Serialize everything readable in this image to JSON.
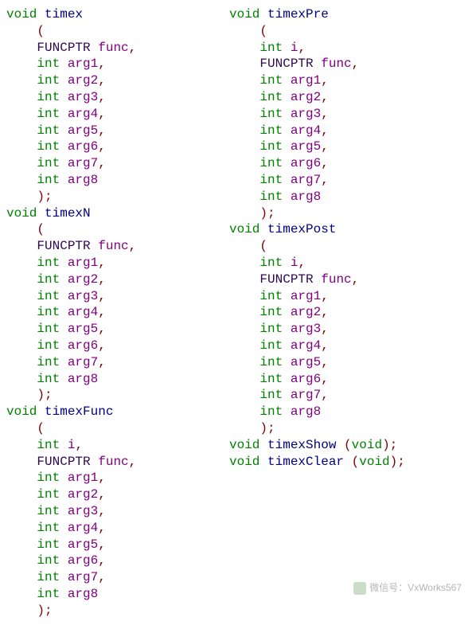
{
  "code": {
    "functions_left": [
      {
        "name": "timex",
        "params": [
          {
            "type": "FUNCPTR",
            "name": "func"
          },
          {
            "type": "int",
            "name": "arg1"
          },
          {
            "type": "int",
            "name": "arg2"
          },
          {
            "type": "int",
            "name": "arg3"
          },
          {
            "type": "int",
            "name": "arg4"
          },
          {
            "type": "int",
            "name": "arg5"
          },
          {
            "type": "int",
            "name": "arg6"
          },
          {
            "type": "int",
            "name": "arg7"
          },
          {
            "type": "int",
            "name": "arg8"
          }
        ]
      },
      {
        "name": "timexN",
        "params": [
          {
            "type": "FUNCPTR",
            "name": "func"
          },
          {
            "type": "int",
            "name": "arg1"
          },
          {
            "type": "int",
            "name": "arg2"
          },
          {
            "type": "int",
            "name": "arg3"
          },
          {
            "type": "int",
            "name": "arg4"
          },
          {
            "type": "int",
            "name": "arg5"
          },
          {
            "type": "int",
            "name": "arg6"
          },
          {
            "type": "int",
            "name": "arg7"
          },
          {
            "type": "int",
            "name": "arg8"
          }
        ]
      },
      {
        "name": "timexFunc",
        "params": [
          {
            "type": "int",
            "name": "i"
          },
          {
            "type": "FUNCPTR",
            "name": "func"
          },
          {
            "type": "int",
            "name": "arg1"
          },
          {
            "type": "int",
            "name": "arg2"
          },
          {
            "type": "int",
            "name": "arg3"
          },
          {
            "type": "int",
            "name": "arg4"
          },
          {
            "type": "int",
            "name": "arg5"
          },
          {
            "type": "int",
            "name": "arg6"
          },
          {
            "type": "int",
            "name": "arg7"
          },
          {
            "type": "int",
            "name": "arg8"
          }
        ]
      }
    ],
    "functions_right": [
      {
        "name": "timexPre",
        "params": [
          {
            "type": "int",
            "name": "i"
          },
          {
            "type": "FUNCPTR",
            "name": "func"
          },
          {
            "type": "int",
            "name": "arg1"
          },
          {
            "type": "int",
            "name": "arg2"
          },
          {
            "type": "int",
            "name": "arg3"
          },
          {
            "type": "int",
            "name": "arg4"
          },
          {
            "type": "int",
            "name": "arg5"
          },
          {
            "type": "int",
            "name": "arg6"
          },
          {
            "type": "int",
            "name": "arg7"
          },
          {
            "type": "int",
            "name": "arg8"
          }
        ]
      },
      {
        "name": "timexPost",
        "params": [
          {
            "type": "int",
            "name": "i"
          },
          {
            "type": "FUNCPTR",
            "name": "func"
          },
          {
            "type": "int",
            "name": "arg1"
          },
          {
            "type": "int",
            "name": "arg2"
          },
          {
            "type": "int",
            "name": "arg3"
          },
          {
            "type": "int",
            "name": "arg4"
          },
          {
            "type": "int",
            "name": "arg5"
          },
          {
            "type": "int",
            "name": "arg6"
          },
          {
            "type": "int",
            "name": "arg7"
          },
          {
            "type": "int",
            "name": "arg8"
          }
        ]
      }
    ],
    "one_liners_right": [
      {
        "name": "timexShow",
        "proto": "(void)"
      },
      {
        "name": "timexClear",
        "proto": "(void)"
      }
    ],
    "keyword_void": "void",
    "keyword_int": "int",
    "type_funcptr": "FUNCPTR"
  },
  "watermark": "微信号：VxWorks567"
}
